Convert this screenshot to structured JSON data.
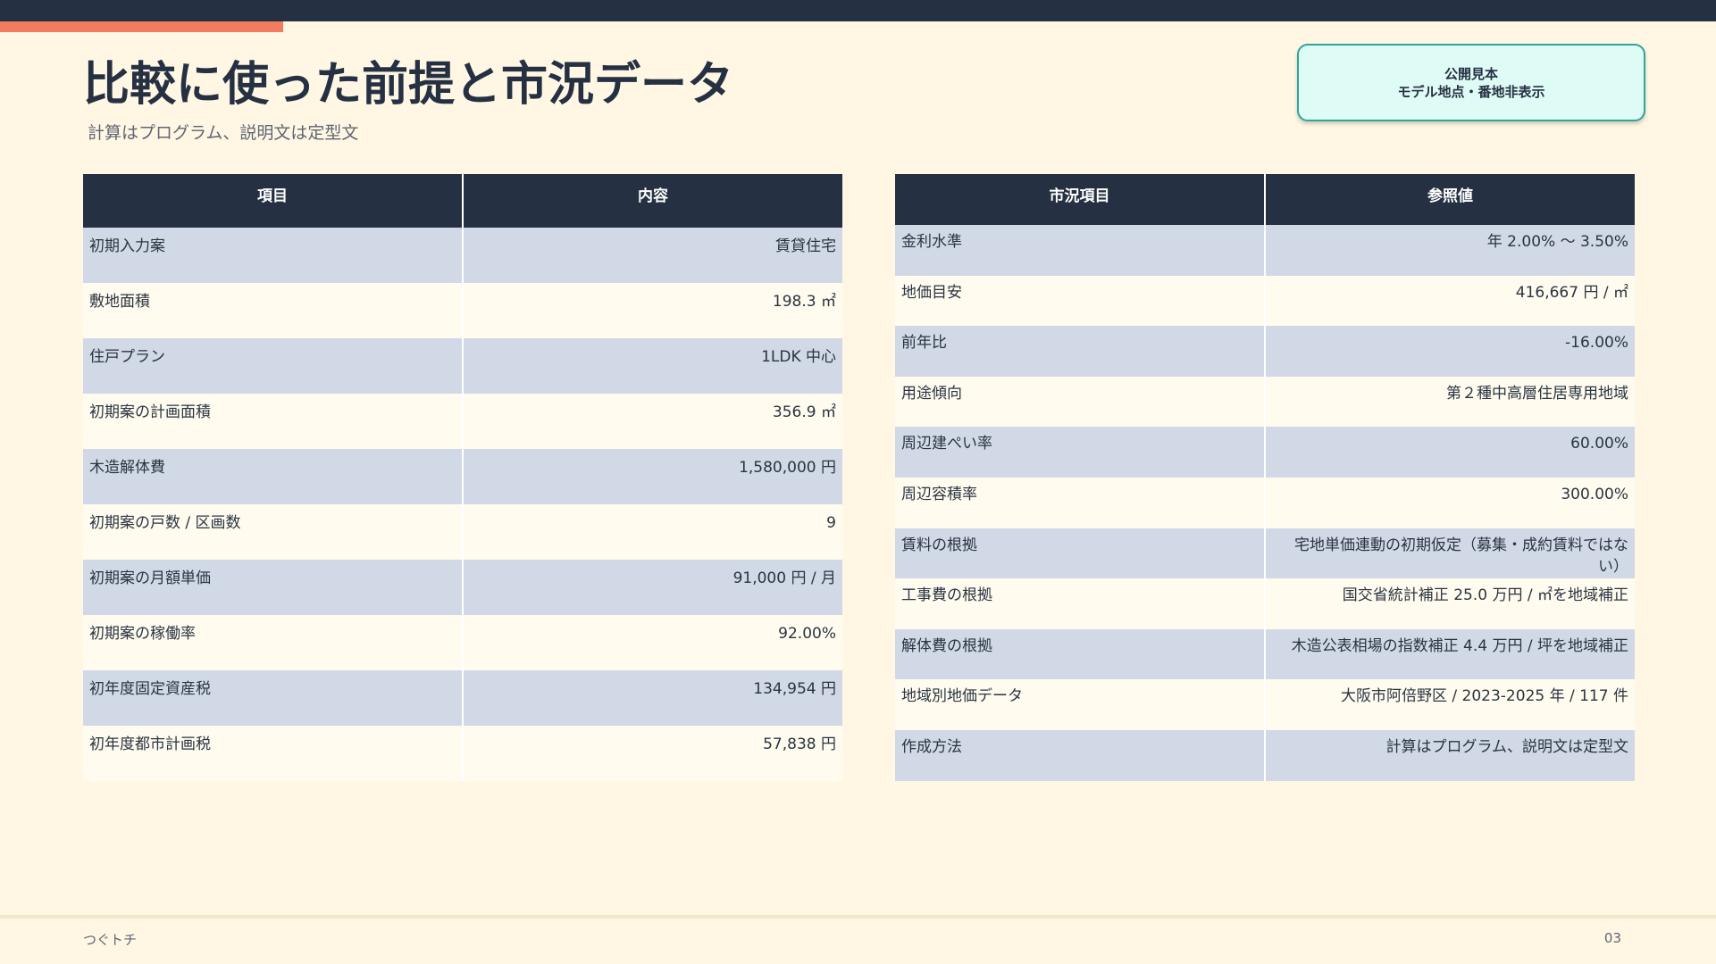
{
  "header": {
    "title": "比較に使った前提と市況データ",
    "subtitle": "計算はプログラム、説明文は定型文"
  },
  "badge": {
    "line1": "公開見本",
    "line2": "モデル地点・番地非表示"
  },
  "premise_table": {
    "headers": [
      "項目",
      "内容"
    ],
    "rows": [
      {
        "label": "初期入力案",
        "value": "賃貸住宅"
      },
      {
        "label": "敷地面積",
        "value": "198.3 ㎡"
      },
      {
        "label": "住戸プラン",
        "value": "1LDK 中心"
      },
      {
        "label": "初期案の計画面積",
        "value": "356.9 ㎡"
      },
      {
        "label": "木造解体費",
        "value": "1,580,000 円"
      },
      {
        "label": "初期案の戸数 / 区画数",
        "value": "9"
      },
      {
        "label": "初期案の月額単価",
        "value": "91,000 円 / 月"
      },
      {
        "label": "初期案の稼働率",
        "value": "92.00%"
      },
      {
        "label": "初年度固定資産税",
        "value": "134,954 円"
      },
      {
        "label": "初年度都市計画税",
        "value": "57,838 円"
      }
    ]
  },
  "market_table": {
    "headers": [
      "市況項目",
      "参照値"
    ],
    "rows": [
      {
        "label": "金利水準",
        "value": "年 2.00% 〜 3.50%"
      },
      {
        "label": "地価目安",
        "value": "416,667 円 / ㎡"
      },
      {
        "label": "前年比",
        "value": "-16.00%"
      },
      {
        "label": "用途傾向",
        "value": "第２種中高層住居専用地域"
      },
      {
        "label": "周辺建ぺい率",
        "value": "60.00%"
      },
      {
        "label": "周辺容積率",
        "value": "300.00%"
      },
      {
        "label": "賃料の根拠",
        "value": "宅地単価連動の初期仮定（募集・成約賃料ではない）"
      },
      {
        "label": "工事費の根拠",
        "value": "国交省統計補正  25.0 万円 / ㎡を地域補正"
      },
      {
        "label": "解体費の根拠",
        "value": "木造公表相場の指数補正  4.4 万円 / 坪を地域補正"
      },
      {
        "label": "地域別地価データ",
        "value": "大阪市阿倍野区  / 2023-2025 年  / 117 件"
      },
      {
        "label": "作成方法",
        "value": "計算はプログラム、説明文は定型文"
      }
    ]
  },
  "footer": {
    "brand": "つぐトチ",
    "page_number": "03"
  }
}
